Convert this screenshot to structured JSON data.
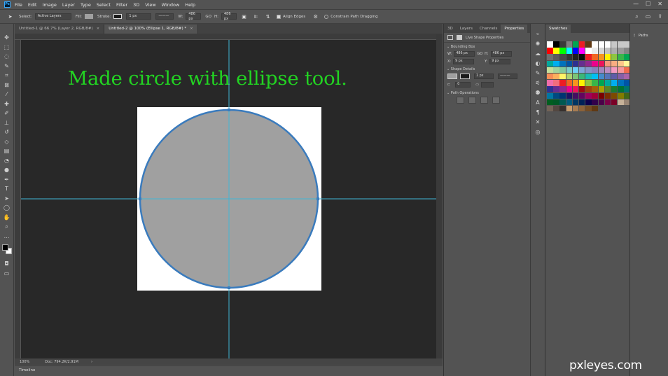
{
  "menu": [
    "File",
    "Edit",
    "Image",
    "Layer",
    "Type",
    "Select",
    "Filter",
    "3D",
    "View",
    "Window",
    "Help"
  ],
  "app_logo": "Ps",
  "window_controls": [
    "—",
    "☐",
    "✕"
  ],
  "options": {
    "select_label": "Select:",
    "select_value": "Active Layers",
    "fill_label": "Fill:",
    "stroke_label": "Stroke:",
    "stroke_width": "1 px",
    "w_label": "W:",
    "w_value": "486 px",
    "link": "GO",
    "h_label": "H:",
    "h_value": "486 px",
    "align_edges": "Align Edges",
    "constrain": "Constrain Path Dragging",
    "fill_color": "#a0a0a0",
    "stroke_color": "#1a1a1a"
  },
  "tabs": [
    {
      "label": "Untitled-1 @ 66.7% (Layer 2, RGB/8#)",
      "close": "×"
    },
    {
      "label": "Untitled-2 @ 100% (Ellipse 1, RGB/8#) *",
      "close": "×"
    }
  ],
  "canvas": {
    "caption": "Made circle with ellipse tool.",
    "circle_fill": "#a0a0a0",
    "circle_stroke": "#3a7bbd",
    "guide_color": "#3fb6d6"
  },
  "status": {
    "zoom": "100%",
    "doc": "Doc: 794.2K/2.91M",
    "arrow": "›"
  },
  "timeline_label": "Timeline",
  "properties": {
    "tabs": [
      "3D",
      "Layers",
      "Channels",
      "Properties"
    ],
    "panel_title": "Live Shape Properties",
    "bounding_box": "Bounding Box",
    "w_label": "W:",
    "w_value": "486 px",
    "link": "GO",
    "h_label": "H:",
    "h_value": "486 px",
    "x_label": "X:",
    "x_value": "9 px",
    "y_label": "Y:",
    "y_value": "9 px",
    "shape_details": "Shape Details",
    "stroke_width": "1 px",
    "corner_value": "0",
    "path_operations": "Path Operations"
  },
  "swatches": {
    "title": "Swatches",
    "colors": [
      "#ffffff",
      "#000000",
      "#3a3a3a",
      "#7f7f7f",
      "#00a651",
      "#ed1c24",
      "#603913",
      "#ffffff",
      "#ffffff",
      "#ffffff",
      "#c8c8c8",
      "#c8c8c8",
      "#c8c8c8",
      "#ff0000",
      "#ffff00",
      "#00ff00",
      "#00ffff",
      "#0000ff",
      "#ff00ff",
      "#ffffff",
      "#ebebeb",
      "#d6d6d6",
      "#c2c2c2",
      "#adadad",
      "#999999",
      "#858585",
      "#707070",
      "#5c5c5c",
      "#474747",
      "#333333",
      "#1f1f1f",
      "#0a0a0a",
      "#ed1c24",
      "#f26522",
      "#f7941d",
      "#fff200",
      "#8dc63f",
      "#39b54a",
      "#00a651",
      "#00a99d",
      "#00aeef",
      "#0072bc",
      "#0054a6",
      "#2e3192",
      "#662d91",
      "#92278f",
      "#ec008c",
      "#ed145b",
      "#f7977a",
      "#f9ad81",
      "#fdc68a",
      "#fff799",
      "#c4df9b",
      "#a3d39c",
      "#82ca9c",
      "#7accc8",
      "#6dcff6",
      "#7da7d9",
      "#8393ca",
      "#8781bd",
      "#a186be",
      "#bd8cbf",
      "#f49ac1",
      "#f5989d",
      "#f26c4f",
      "#f68e56",
      "#fbaf5d",
      "#fff568",
      "#acd373",
      "#7cc576",
      "#3bb878",
      "#1abbb4",
      "#00bff3",
      "#448ccb",
      "#5574b9",
      "#605ca8",
      "#855fa8",
      "#a864a8",
      "#f06eaa",
      "#f26d7d",
      "#ed1c24",
      "#f26522",
      "#f7941d",
      "#fff200",
      "#8dc63f",
      "#39b54a",
      "#00a651",
      "#00a99d",
      "#00aeef",
      "#0072bc",
      "#0054a6",
      "#2e3192",
      "#662d91",
      "#92278f",
      "#ec008c",
      "#ed145b",
      "#9e0b0f",
      "#a0410d",
      "#a3620a",
      "#aba000",
      "#598527",
      "#1a7b30",
      "#007236",
      "#00746b",
      "#0076a3",
      "#004a80",
      "#003471",
      "#1b1464",
      "#440e62",
      "#630460",
      "#9e005d",
      "#9e0039",
      "#790000",
      "#7b2e00",
      "#7d4900",
      "#827b00",
      "#406618",
      "#005e20",
      "#005826",
      "#005952",
      "#005b7f",
      "#003663",
      "#002157",
      "#0d004c",
      "#32004b",
      "#4b0049",
      "#7b0046",
      "#7a0026",
      "#c7b299",
      "#998675",
      "#736357",
      "#534741",
      "#37302d",
      "#c69c6d",
      "#a67c52",
      "#8c6239",
      "#754c24",
      "#603913"
    ]
  },
  "paths_label": "Paths"
}
